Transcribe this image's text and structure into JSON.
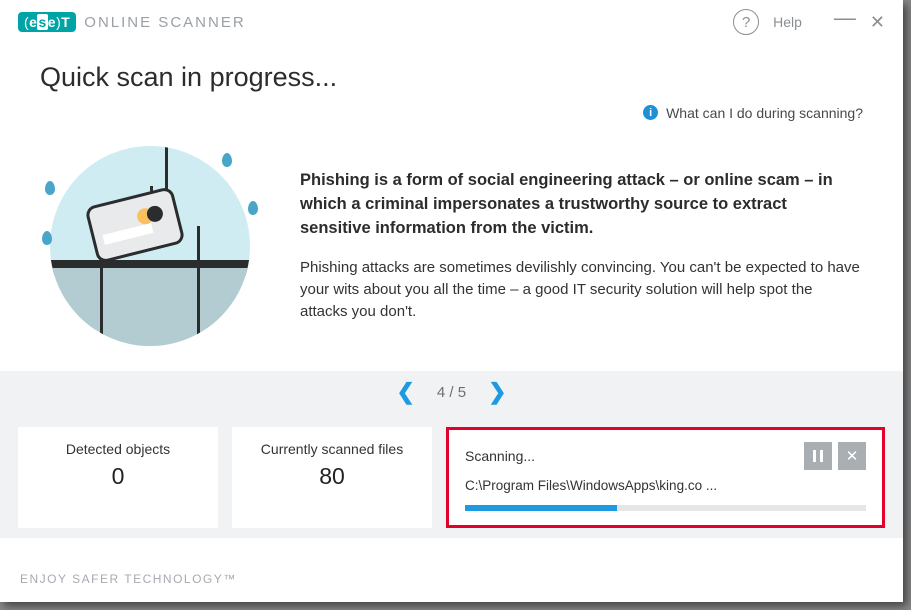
{
  "app": {
    "brand_left": "e",
    "brand_mid": "s",
    "brand_mid2": "e",
    "brand_right": "T",
    "name": "ONLINE SCANNER"
  },
  "titlebar": {
    "help": "Help"
  },
  "heading": "Quick scan in progress...",
  "infolink": "What can I do during scanning?",
  "tip": {
    "bold": "Phishing is a form of social engineering attack – or online scam – in which a criminal impersonates a trustworthy source to extract sensitive information from the victim.",
    "para": "Phishing attacks are sometimes devilishly convincing. You can't be expected to have your wits about you all the time – a good IT security solution will help spot the attacks you don't."
  },
  "pager": {
    "current": 4,
    "total": 5,
    "text": "4 / 5"
  },
  "stats": {
    "detected_label": "Detected objects",
    "detected_value": "0",
    "scanned_label": "Currently scanned files",
    "scanned_value": "80"
  },
  "scan": {
    "status": "Scanning...",
    "path": "C:\\Program Files\\WindowsApps\\king.co ...",
    "progress_percent": 38
  },
  "footer": "ENJOY SAFER TECHNOLOGY™"
}
